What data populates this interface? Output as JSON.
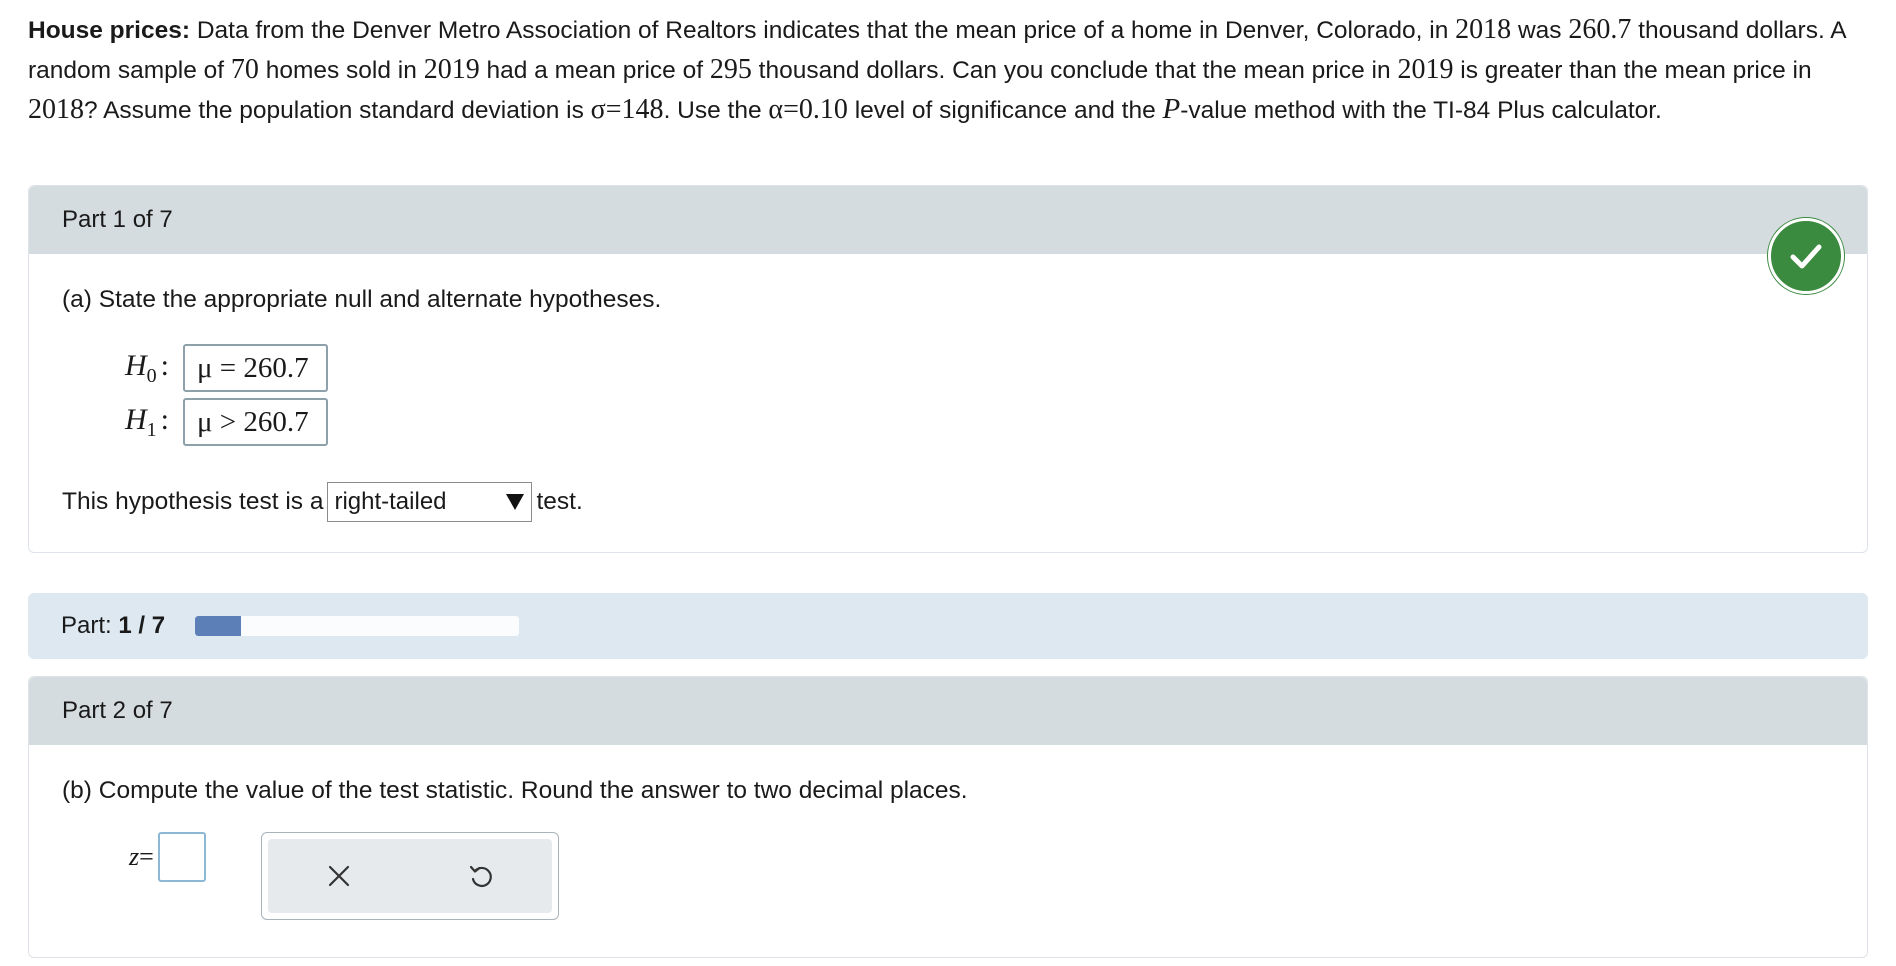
{
  "problem": {
    "bold_lead": "House prices:",
    "t1": " Data from the Denver Metro Association of Realtors indicates that the mean price of a home in Denver, Colorado, in ",
    "year2018": "2018",
    "t2": " was ",
    "mean2018": "260.7",
    "t3": " thousand dollars. A random sample of ",
    "n": "70",
    "t4": " homes sold in ",
    "year2019": "2019",
    "t5": " had a mean price of ",
    "mean2019": "295",
    "t6": " thousand dollars. Can you conclude that the mean price in ",
    "year2019b": "2019",
    "t7": " is greater than the mean price in ",
    "year2018b": "2018",
    "t8": "? Assume the population standard deviation is ",
    "sigma": "σ=148",
    "t9": ". Use the ",
    "alpha": "α=0.10",
    "t10": " level of significance and the ",
    "pvar": "P",
    "t11": "-value method with the TI-84 Plus calculator."
  },
  "part1": {
    "header": "Part 1 of 7",
    "question": "(a) State the appropriate null and alternate hypotheses.",
    "h0_label": "H",
    "h0_sub": "0",
    "h0_value": "μ = 260.7",
    "h1_label": "H",
    "h1_sub": "1",
    "h1_value": "μ > 260.7",
    "colon": ":",
    "test_prefix": "This hypothesis test is a",
    "test_type": "right-tailed",
    "test_suffix": "test."
  },
  "progress": {
    "label": "Part:",
    "value": "1 / 7",
    "fraction": 0.143
  },
  "part2": {
    "header": "Part 2 of 7",
    "question": "(b) Compute the value of the test statistic. Round the answer to two decimal places.",
    "z_label": "z",
    "equals": "=",
    "z_value": ""
  },
  "colors": {
    "check_green": "#3a8a3f",
    "progress_fill": "#5b7fb6",
    "card_header": "#d5dcdf",
    "progress_bg": "#dde8f1"
  },
  "icons": [
    "check-icon",
    "dropdown-arrow-icon",
    "clear-icon",
    "undo-icon"
  ]
}
